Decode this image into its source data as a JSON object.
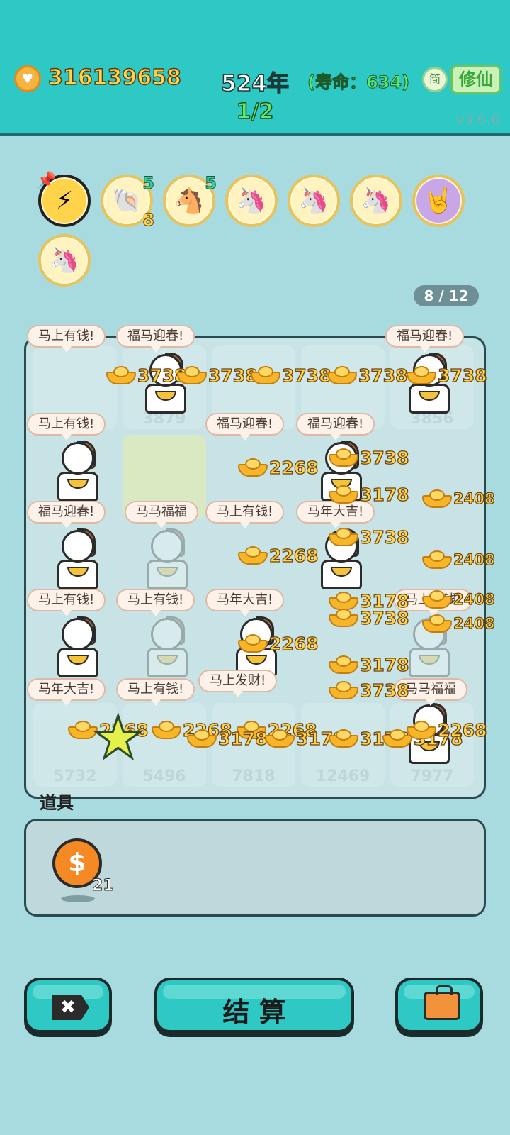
{
  "header": {
    "coins": "316139658",
    "year": "524年",
    "life": "(寿命：634)",
    "wave": "1/2",
    "jian": "简",
    "xiuxian": "修仙",
    "version": "v3.6.6"
  },
  "buffs": [
    {
      "icon": "lightning-icon",
      "glyph": "⚡",
      "top": "",
      "bottom": ""
    },
    {
      "icon": "shell-icon",
      "glyph": "🐚",
      "top": "5",
      "bottom": "8"
    },
    {
      "icon": "horse-pair-icon",
      "glyph": "🐴",
      "top": "5",
      "bottom": ""
    },
    {
      "icon": "unicorn-icon",
      "glyph": "🦄",
      "top": "",
      "bottom": ""
    },
    {
      "icon": "unicorn-icon",
      "glyph": "🦄",
      "top": "",
      "bottom": ""
    },
    {
      "icon": "unicorn-icon",
      "glyph": "🦄",
      "top": "",
      "bottom": ""
    },
    {
      "icon": "rock-hand-icon",
      "glyph": "🤘",
      "top": "",
      "bottom": ""
    },
    {
      "icon": "unicorn-icon",
      "glyph": "🦄",
      "top": "",
      "bottom": ""
    }
  ],
  "page_indicator": "8 / 12",
  "board": {
    "cell_numbers": [
      "3879",
      "3856",
      "5732",
      "5496",
      "7818",
      "12469",
      "7977"
    ],
    "bubbles": [
      "马上有钱!",
      "福马迎春!",
      "福马迎春!",
      "马上有钱!",
      "福马迎春!",
      "福马迎春!",
      "福马迎春!",
      "马马福福",
      "马上有钱!",
      "马年大吉!",
      "马上有钱!",
      "马上有钱!",
      "马年大吉!",
      "马上有钱!",
      "马年大吉!",
      "马上有钱!",
      "马上发财!",
      "马马福福"
    ],
    "gold_values": [
      "3738",
      "3738",
      "3738",
      "3738",
      "3738",
      "2268",
      "3738",
      "3178",
      "2408",
      "2268",
      "3738",
      "3178",
      "2408",
      "2268",
      "3178",
      "2408",
      "3738",
      "2408",
      "2268",
      "3178",
      "3738",
      "2268",
      "2268",
      "3178",
      "3178",
      "3178",
      "3178",
      "3178",
      "2268"
    ]
  },
  "items": {
    "label": "道具",
    "coin_count": "21"
  },
  "buttons": {
    "close": "✖",
    "settle": "结 算"
  }
}
